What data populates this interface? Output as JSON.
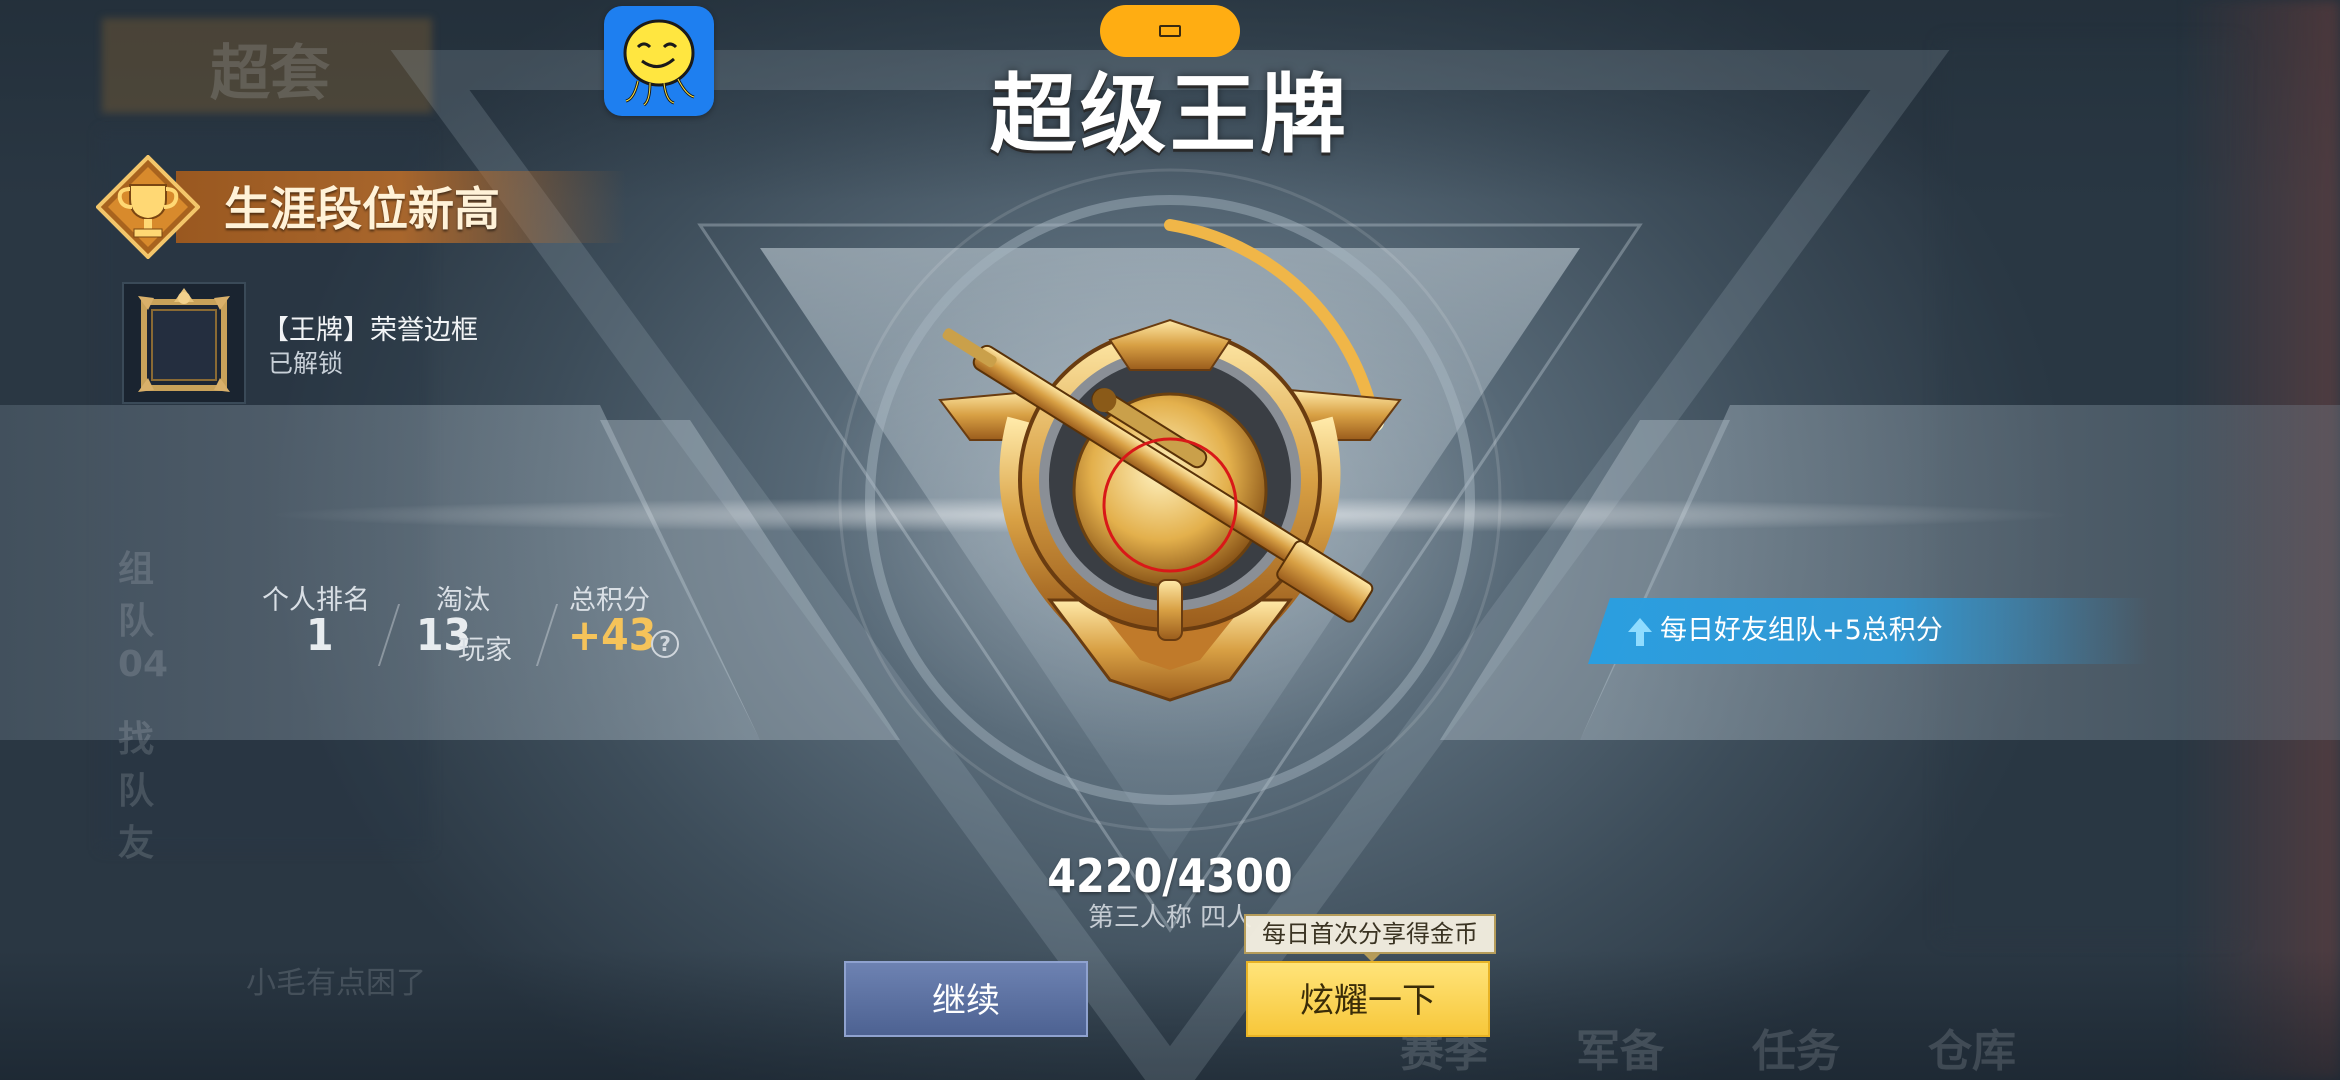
{
  "title": "超级王牌",
  "career_banner": {
    "label": "生涯段位新高"
  },
  "reward": {
    "name": "【王牌】荣誉边框",
    "status": "已解锁"
  },
  "stats": {
    "rank_label": "个人排名",
    "rank_value": "1",
    "kills_label": "淘汰",
    "kills_value": "13",
    "kills_unit": "玩家",
    "points_label": "总积分",
    "points_value": "+43",
    "help_symbol": "?"
  },
  "friend_bonus": {
    "text": "每日好友组队+5总积分"
  },
  "progress": {
    "text": "4220/4300",
    "current": 4220,
    "max": 4300,
    "mode": "第三人称 四人"
  },
  "share_tip": "每日首次分享得金币",
  "buttons": {
    "continue": "继续",
    "share": "炫耀一下"
  },
  "colors": {
    "accent_gold": "#f5c35a",
    "button_blue": "#5a6fa0",
    "button_yellow": "#f9d24e",
    "friend_banner": "#2aa0dc",
    "orange_pill": "#ffad12",
    "app_logo_blue": "#1e7ff0"
  },
  "icons": {
    "app_logo": "smiley-octopus-logo-icon",
    "trophy": "trophy-icon",
    "friend_up": "up-arrow-icon",
    "help": "question-mark-icon",
    "emblem": "ace-rank-emblem-icon"
  }
}
